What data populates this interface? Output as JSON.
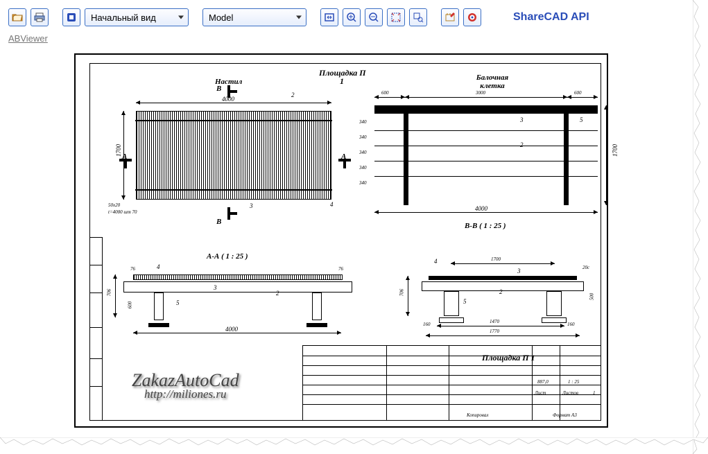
{
  "toolbar": {
    "select_view": "Начальный вид",
    "select_layout": "Model",
    "api_label": "ShareCAD API"
  },
  "viewer_link": "ABViewer",
  "drawing": {
    "main_title_1": "Площадка П",
    "main_title_2": "1",
    "label_deck": "Настил",
    "label_grid": "Балочная\nклетка",
    "section_AA_title": "А-А ( 1 : 25 )",
    "section_BB_title": "В-В ( 1 : 25 )",
    "dim_4000": "4000",
    "dim_1700": "1700",
    "dim_600": "600",
    "dim_3000": "3000",
    "dim_340_a": "340",
    "dim_340_b": "340",
    "dim_340_c": "340",
    "dim_340_d": "340",
    "dim_340_e": "340",
    "dim_706": "706",
    "dim_600b": "600",
    "dim_160": "160",
    "dim_1470": "1470",
    "dim_1770": "1770",
    "dim_76": "76",
    "dim_76b": "76",
    "dim_50x20": "50x20",
    "dim_t4000": "t=4000 шт 70",
    "dim_20s": "20с",
    "ref_2": "2",
    "ref_3": "3",
    "ref_4": "4",
    "ref_5": "5",
    "mark_A": "A",
    "mark_B": "В",
    "titleblock_title": "Площадка П 1",
    "mass": "887,0",
    "scale": "1 : 25",
    "sheet_label": "Лист",
    "sheets_label": "Листов",
    "sheets_val": "1",
    "format": "Формат А3",
    "copier": "Копировал"
  },
  "watermark": {
    "line1": "ZakazAutoCad",
    "line2": "http://miliones.ru"
  }
}
